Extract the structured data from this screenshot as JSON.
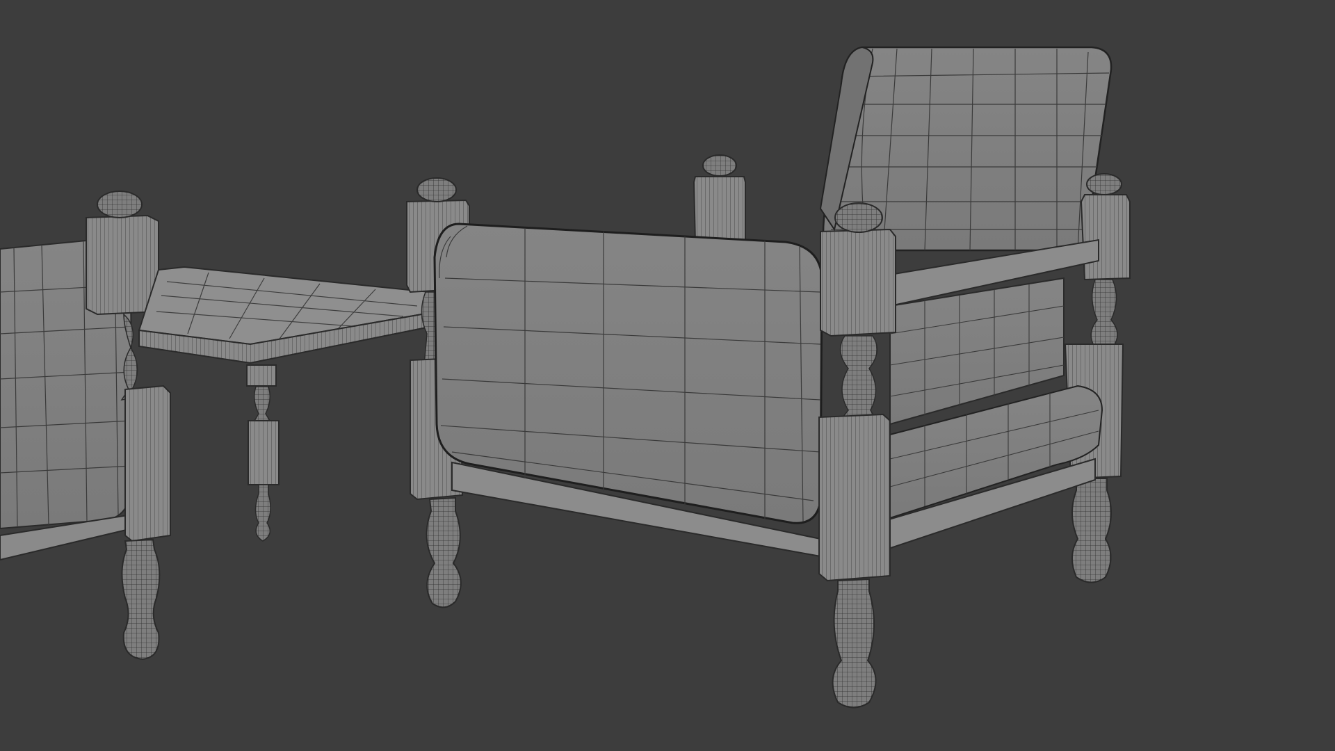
{
  "viewport": {
    "mode": "wireframe-overlay",
    "background_color": "#3d3d3d",
    "mesh_color": "#8a8a8a",
    "edge_color": "#2a2a2a",
    "objects": [
      {
        "id": "armchair-left",
        "label": ""
      },
      {
        "id": "coffee-table",
        "label": ""
      },
      {
        "id": "armchair-right",
        "label": ""
      }
    ]
  }
}
